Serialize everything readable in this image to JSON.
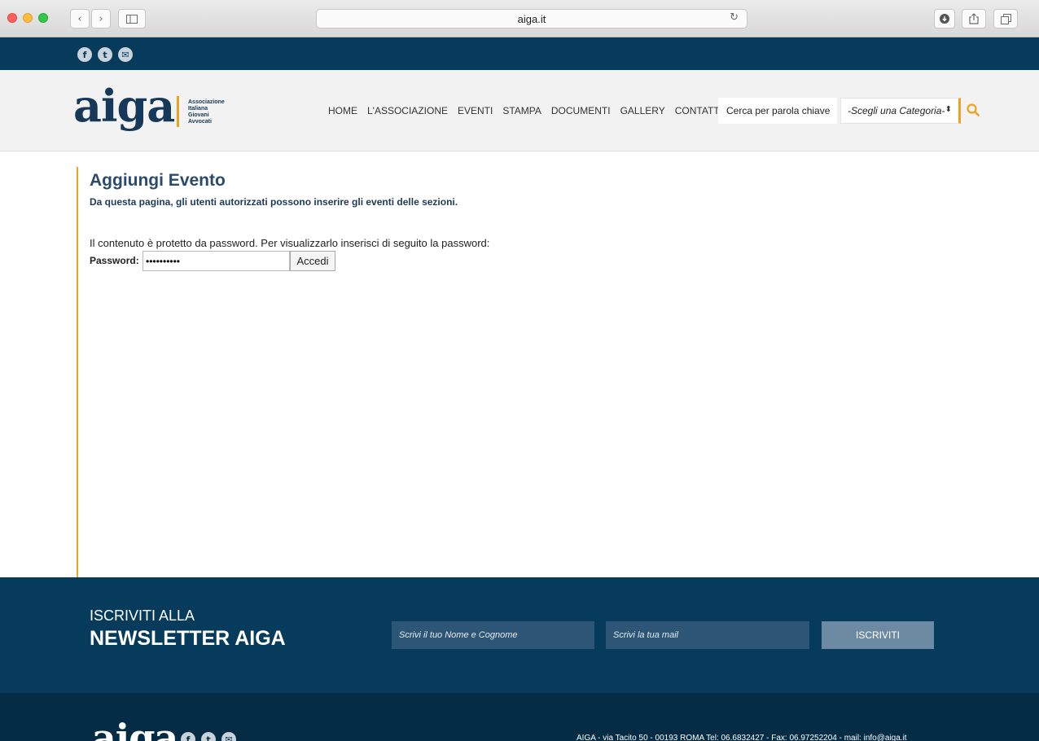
{
  "browser": {
    "url": "aiga.it"
  },
  "social": {
    "facebook_icon": "f",
    "twitter_icon": "t",
    "mail_icon": "✉"
  },
  "header": {
    "logo_text": "aiga",
    "logo_sub": [
      "Associazione",
      "Italiana",
      "Giovani",
      "Avvocati"
    ],
    "nav": [
      "HOME",
      "L'ASSOCIAZIONE",
      "EVENTI",
      "STAMPA",
      "DOCUMENTI",
      "GALLERY",
      "CONTATTI"
    ],
    "search_placeholder": "Cerca per parola chiave",
    "category_selected": "-Scegli una Categoria-"
  },
  "content": {
    "title": "Aggiungi Evento",
    "subtitle": "Da questa pagina, gli utenti autorizzati possono inserire gli eventi delle sezioni.",
    "protected_message": "Il contenuto è protetto da password. Per visualizzarlo inserisci di seguito la password:",
    "password_label": "Password:",
    "password_value": "••••••••••",
    "submit_label": "Accedi"
  },
  "newsletter": {
    "line1": "ISCRIVITI ALLA",
    "line2": "NEWSLETTER AIGA",
    "name_placeholder": "Scrivi il tuo Nome e Cognome",
    "email_placeholder": "Scrivi la tua mail",
    "submit_label": "ISCRIVITI"
  },
  "footer": {
    "logo_text": "aiga",
    "contact": "AIGA - via Tacito 50 - 00193 ROMA Tel: 06.6832427 - Fax: 06.97252204 - mail: info@aiga.it"
  },
  "colors": {
    "primary_dark": "#073b5c",
    "accent_orange": "#f0a020",
    "footer_dark": "#042c45"
  }
}
